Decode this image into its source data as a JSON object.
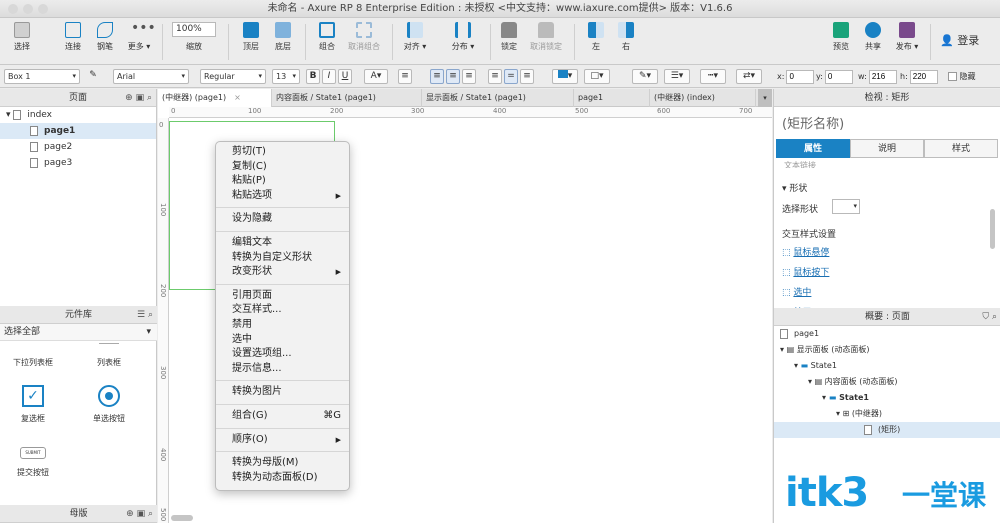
{
  "window": {
    "title": "未命名 - Axure RP 8 Enterprise Edition : 未授权     <中文支持：www.iaxure.com提供> 版本：V1.6.6"
  },
  "toolbar": {
    "select": "选择",
    "connect": "连接",
    "pen": "钢笔",
    "more": "更多 ▾",
    "zoom_value": "100%",
    "zoom_label": "缩放",
    "top": "顶层",
    "bottom": "底层",
    "group": "组合",
    "ungroup": "取消组合",
    "align": "对齐 ▾",
    "distribute": "分布 ▾",
    "lock": "锁定",
    "unlock": "取消锁定",
    "left": "左",
    "right": "右",
    "preview": "预览",
    "share": "共享",
    "publish": "发布 ▾",
    "login": "登录"
  },
  "format": {
    "widget_name": "Box 1",
    "font": "Arial",
    "style": "Regular",
    "size": "13",
    "x_label": "x:",
    "x": "0",
    "y_label": "y:",
    "y": "0",
    "w_label": "w:",
    "w": "216",
    "h_label": "h:",
    "h": "220",
    "hide": "隐藏"
  },
  "pages_panel": {
    "title": "页面",
    "items": [
      "index",
      "page1",
      "page2",
      "page3"
    ]
  },
  "library_panel": {
    "title": "元件库",
    "select_all": "选择全部",
    "widgets": [
      "下拉列表框",
      "列表框",
      "复选框",
      "单选按钮",
      "提交按钮"
    ],
    "submit_badge": "SUBMIT"
  },
  "masters_panel": {
    "title": "母版"
  },
  "tabs": [
    "(中继器) (page1)",
    "内容面板 / State1 (page1)",
    "显示面板 / State1 (page1)",
    "page1",
    "(中继器) (index)"
  ],
  "ruler": {
    "h": [
      "0",
      "100",
      "200",
      "300",
      "400",
      "500",
      "600",
      "700"
    ],
    "v": [
      "0",
      "100",
      "200",
      "300",
      "400",
      "500"
    ]
  },
  "context_menu": {
    "groups": [
      [
        {
          "label": "剪切(T)"
        },
        {
          "label": "复制(C)"
        },
        {
          "label": "粘贴(P)"
        },
        {
          "label": "粘贴选项",
          "sub": true
        }
      ],
      [
        {
          "label": "设为隐藏"
        }
      ],
      [
        {
          "label": "编辑文本"
        },
        {
          "label": "转换为自定义形状"
        },
        {
          "label": "改变形状",
          "sub": true
        }
      ],
      [
        {
          "label": "引用页面"
        },
        {
          "label": "交互样式..."
        },
        {
          "label": "禁用"
        },
        {
          "label": "选中"
        },
        {
          "label": "设置选项组..."
        },
        {
          "label": "提示信息..."
        }
      ],
      [
        {
          "label": "转换为图片"
        }
      ],
      [
        {
          "label": "组合(G)",
          "shortcut": "⌘G"
        }
      ],
      [
        {
          "label": "顺序(O)",
          "sub": true
        }
      ],
      [
        {
          "label": "转换为母版(M)"
        },
        {
          "label": "转换为动态面板(D)"
        }
      ]
    ]
  },
  "inspector": {
    "title": "检视 : 矩形",
    "name_placeholder": "(矩形名称)",
    "tabs": [
      "属性",
      "说明",
      "样式"
    ],
    "cut_text": "文本链接",
    "shape_section": "形状",
    "select_shape": "选择形状",
    "interaction_title": "交互样式设置",
    "links": [
      "鼠标悬停",
      "鼠标按下",
      "选中",
      "禁用"
    ]
  },
  "outline": {
    "title": "概要 : 页面",
    "items": [
      {
        "label": "page1",
        "depth": 0
      },
      {
        "label": "显示面板 (动态面板)",
        "depth": 1
      },
      {
        "label": "State1",
        "depth": 2
      },
      {
        "label": "内容面板 (动态面板)",
        "depth": 3
      },
      {
        "label": "State1",
        "depth": 4
      },
      {
        "label": "(中继器)",
        "depth": 5
      },
      {
        "label": "(矩形)",
        "depth": 6
      }
    ]
  },
  "watermark": {
    "main": "itk3",
    "sub": "一堂课"
  },
  "colors": {
    "accent": "#1a82c4",
    "selection": "#6ccb6c"
  }
}
